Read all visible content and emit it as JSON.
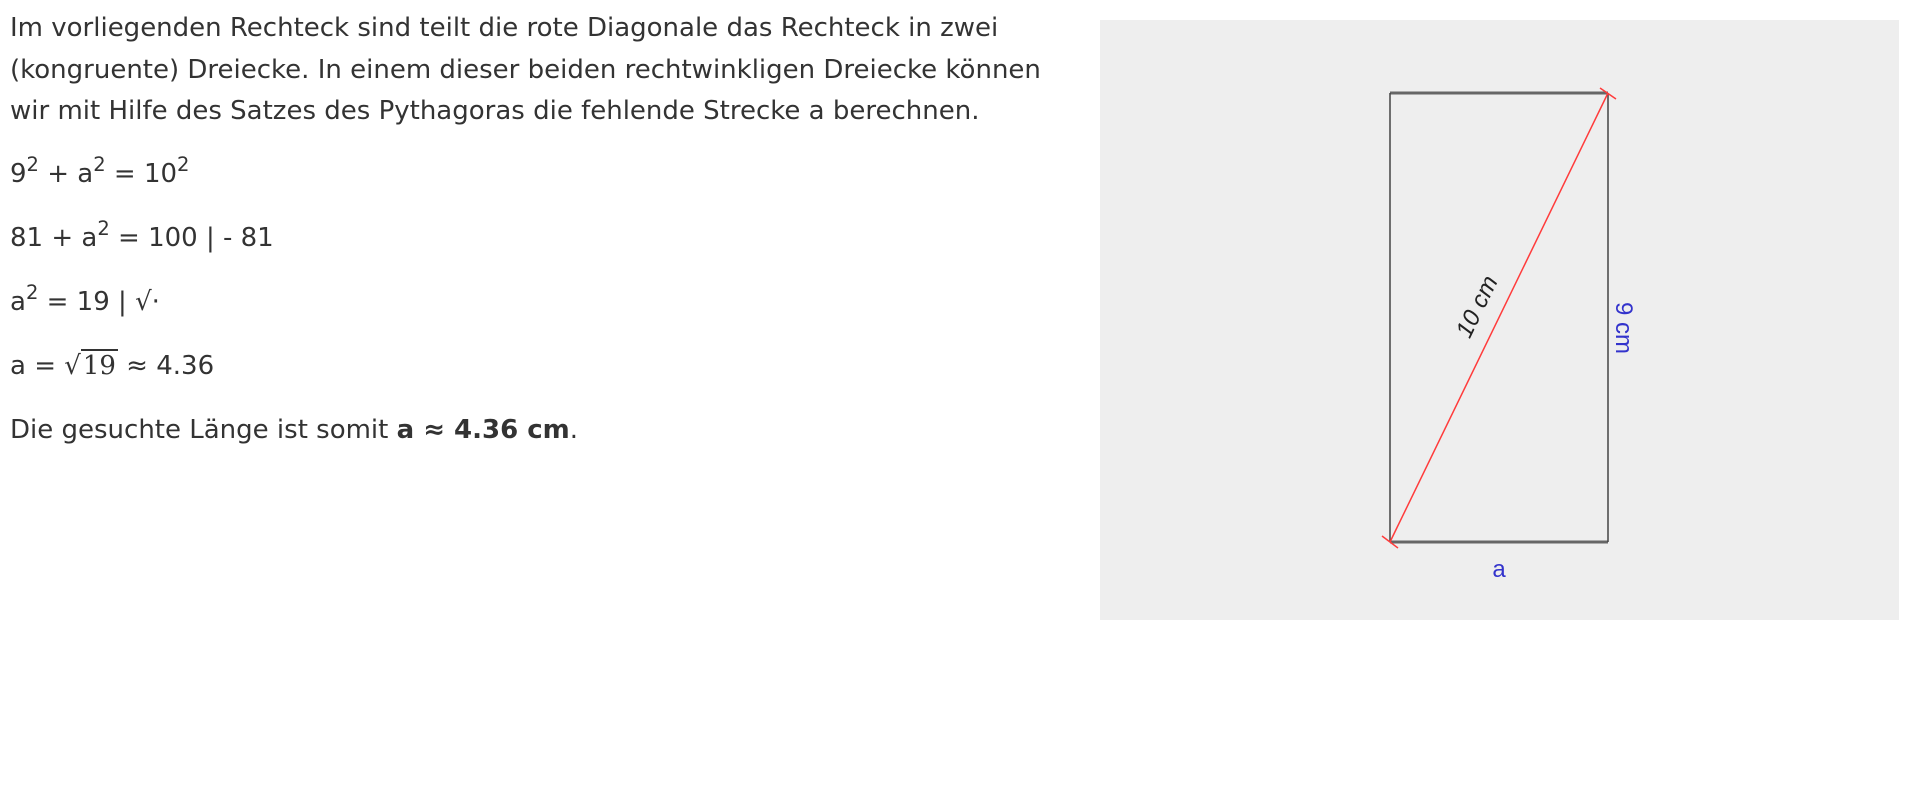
{
  "paragraph": "Im vorliegenden Rechteck sind teilt die rote Diagonale das Rechteck in zwei (kongruente) Dreiecke. In einem dieser beiden rechtwinkligen Dreiecke können wir mit Hilfe des Satzes des Pythagoras die fehlende Strecke a berechnen.",
  "equations": {
    "eq1": {
      "a": "9",
      "b": "+ a",
      "c": "= 10",
      "exp": "2"
    },
    "eq2": {
      "a": "81 + a",
      "exp": "2",
      "b": "= 100 | - 81"
    },
    "eq3": {
      "a": "a",
      "exp": "2",
      "b": "= 19 | ",
      "root": "√",
      "radicand": "·"
    },
    "eq4": {
      "a": "a = ",
      "root": "√",
      "radicand": "19",
      "b": " ≈ 4.36"
    }
  },
  "conclusion": {
    "prefix": "Die gesuchte Länge ist somit ",
    "result": "a ≈ 4.36 cm",
    "suffix": "."
  },
  "diagram": {
    "diagonal_label": "10 cm",
    "side_label": "9 cm",
    "base_label": "a",
    "colors": {
      "diagonal": "#ff3b3b",
      "label_blue": "#3333cc",
      "edge": "#555555",
      "background": "#eeeeee"
    }
  }
}
